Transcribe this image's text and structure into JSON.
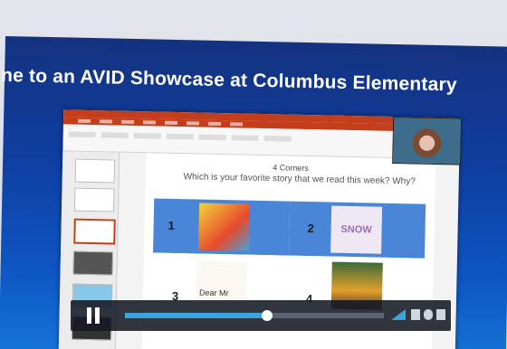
{
  "banner": {
    "text": "ne to an AVID Showcase at Columbus Elementary"
  },
  "slide": {
    "title": "4 Corners",
    "question": "Which is your favorite story  that we read this week? Why?",
    "corners": [
      {
        "number": "1",
        "book_label": ""
      },
      {
        "number": "2",
        "book_label": "SNOW"
      },
      {
        "number": "3",
        "book_label": "Dear Mr"
      },
      {
        "number": "4",
        "book_label": ""
      }
    ]
  },
  "player": {
    "progress": 0.55,
    "state": "paused",
    "icons": [
      "pause-icon",
      "volume-icon",
      "cc-icon",
      "settings-icon",
      "fullscreen-icon"
    ]
  },
  "colors": {
    "accent_blue": "#4a86d8",
    "ppt_red": "#c43e1c",
    "progress": "#3aa4e0"
  }
}
